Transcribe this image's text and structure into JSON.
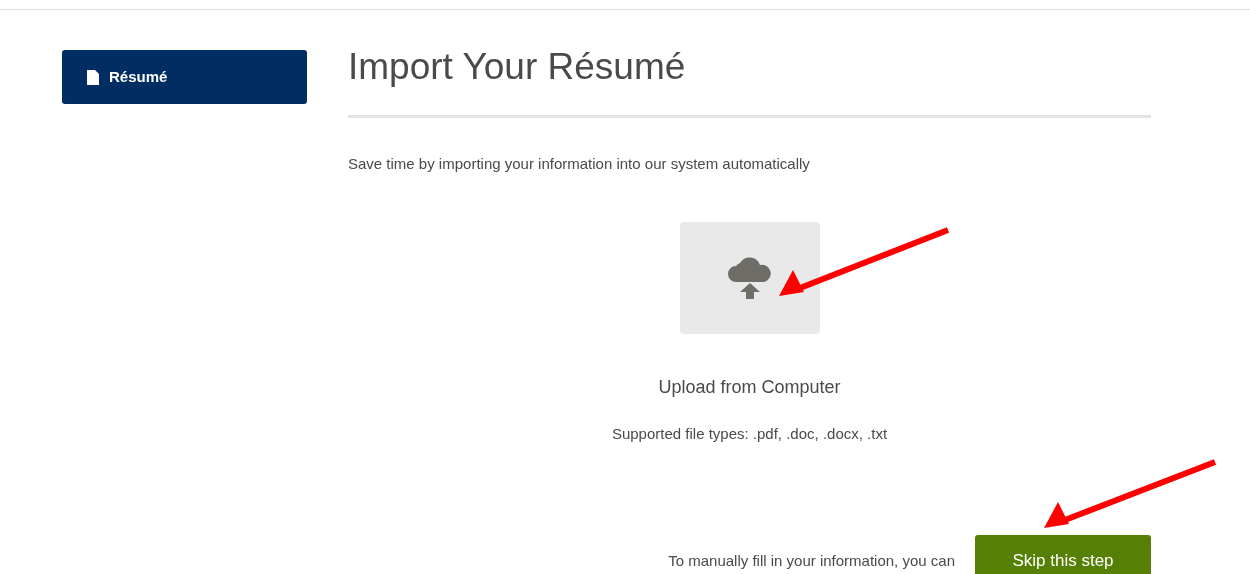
{
  "sidebar": {
    "items": [
      {
        "label": "Résumé",
        "selected": true
      }
    ]
  },
  "main": {
    "title": "Import Your Résumé",
    "intro": "Save time by importing your information into our system automatically",
    "upload": {
      "label": "Upload from Computer",
      "supported": "Supported file types: .pdf, .doc, .docx, .txt"
    },
    "manual": {
      "text": "To manually fill in your information, you can",
      "button": "Skip this step"
    }
  }
}
